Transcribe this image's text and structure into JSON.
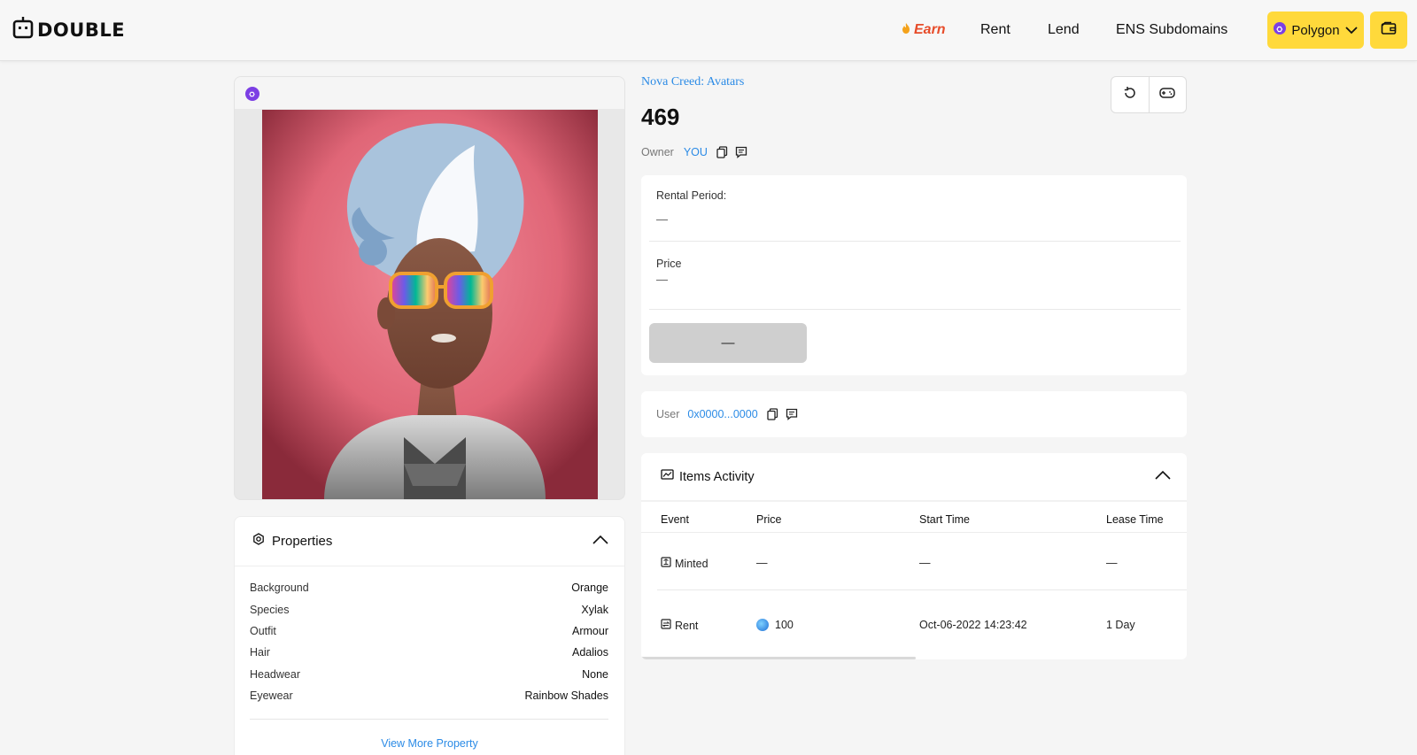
{
  "header": {
    "logo_text": "DOUBLE",
    "nav": {
      "earn": "Earn",
      "rent": "Rent",
      "lend": "Lend",
      "ens": "ENS Subdomains"
    },
    "network_label": "Polygon"
  },
  "nft": {
    "collection": "Nova Creed: Avatars",
    "token_id": "469",
    "owner_label": "Owner",
    "owner_value": "YOU"
  },
  "rental": {
    "period_label": "Rental Period:",
    "period_value": "—",
    "price_label": "Price",
    "price_value": "—",
    "action_label": "—"
  },
  "user": {
    "label": "User",
    "address": "0x0000...0000"
  },
  "properties": {
    "title": "Properties",
    "items": [
      {
        "key": "Background",
        "value": "Orange"
      },
      {
        "key": "Species",
        "value": "Xylak"
      },
      {
        "key": "Outfit",
        "value": "Armour"
      },
      {
        "key": "Hair",
        "value": "Adalios"
      },
      {
        "key": "Headwear",
        "value": "None"
      },
      {
        "key": "Eyewear",
        "value": "Rainbow Shades"
      }
    ],
    "view_more": "View More Property"
  },
  "activity": {
    "title": "Items Activity",
    "columns": [
      "Event",
      "Price",
      "Start Time",
      "Lease Time"
    ],
    "rows": [
      {
        "event": "Minted",
        "price": "—",
        "start": "—",
        "lease": "—"
      },
      {
        "event": "Rent",
        "price": "100",
        "start": "Oct-06-2022 14:23:42",
        "lease": "1 Day"
      }
    ]
  },
  "colors": {
    "accent_yellow": "#ffd93b",
    "link_blue": "#2b8be6",
    "earn_red": "#e74c2a",
    "polygon_purple": "#7c3fe4",
    "art_background": "#e7707f"
  }
}
